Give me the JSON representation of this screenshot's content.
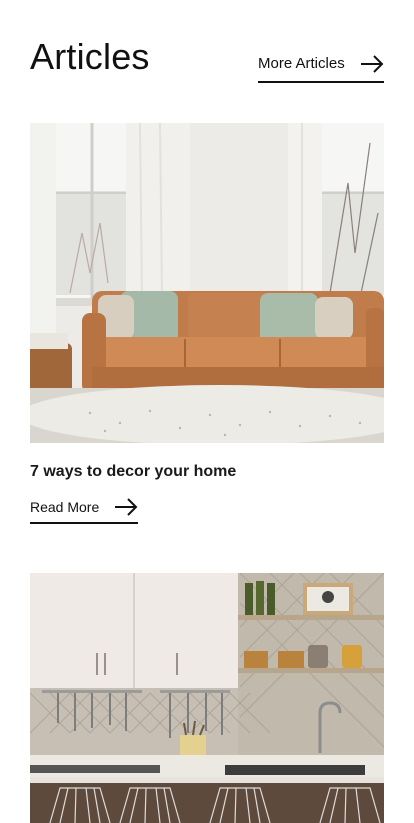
{
  "header": {
    "title": "Articles",
    "more_link": "More Articles"
  },
  "articles": [
    {
      "title": "7 ways to decor your home",
      "read_more": "Read More",
      "image": "living-room-leather-sofa-photo"
    },
    {
      "image": "kitchen-interior-photo"
    }
  ],
  "icons": {
    "arrow": "arrow-right-icon"
  }
}
